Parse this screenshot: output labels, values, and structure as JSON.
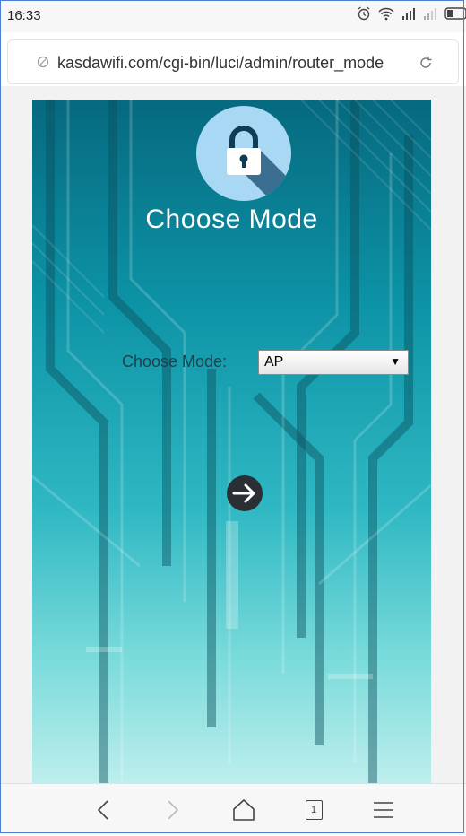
{
  "status_bar": {
    "time": "16:33",
    "icons": [
      "alarm-icon",
      "wifi-icon",
      "signal-icon",
      "signal-weak-icon",
      "battery-icon"
    ]
  },
  "browser": {
    "url": "kasdawifi.com/cgi-bin/luci/admin/router_mode",
    "tab_count": "1"
  },
  "page": {
    "title": "Choose Mode",
    "mode_label": "Choose Mode:",
    "mode_value": "AP",
    "select_arrow": "▼"
  },
  "colors": {
    "hero_top": "#06697f",
    "hero_bottom": "#bdeeed",
    "lock_circle": "#a9d8f5",
    "next_button": "#2a2f33"
  }
}
